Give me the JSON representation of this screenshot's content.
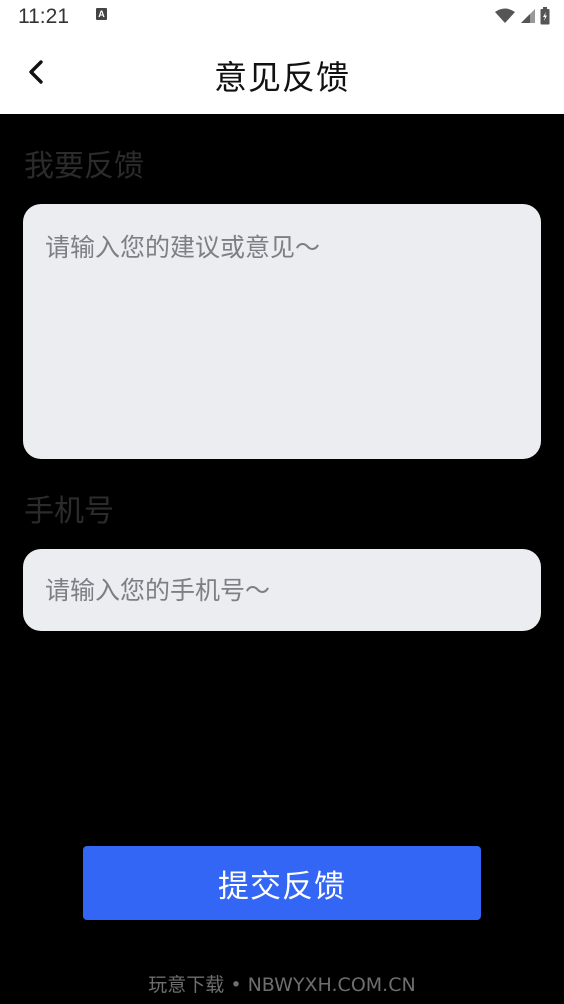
{
  "status_bar": {
    "time": "11:21",
    "notification_icon": "a-notification-icon",
    "icons": [
      "wifi-icon",
      "signal-icon",
      "battery-icon"
    ]
  },
  "header": {
    "back_icon": "chevron-left-icon",
    "title": "意见反馈"
  },
  "form": {
    "feedback_label": "我要反馈",
    "feedback_placeholder": "请输入您的建议或意见～",
    "phone_label": "手机号",
    "phone_placeholder": "请输入您的手机号～"
  },
  "submit_label": "提交反馈",
  "watermark": "玩意下载 • NBWYXH.COM.CN",
  "colors": {
    "background": "#000000",
    "input_background": "#ecedf1",
    "accent": "#3366f5"
  }
}
